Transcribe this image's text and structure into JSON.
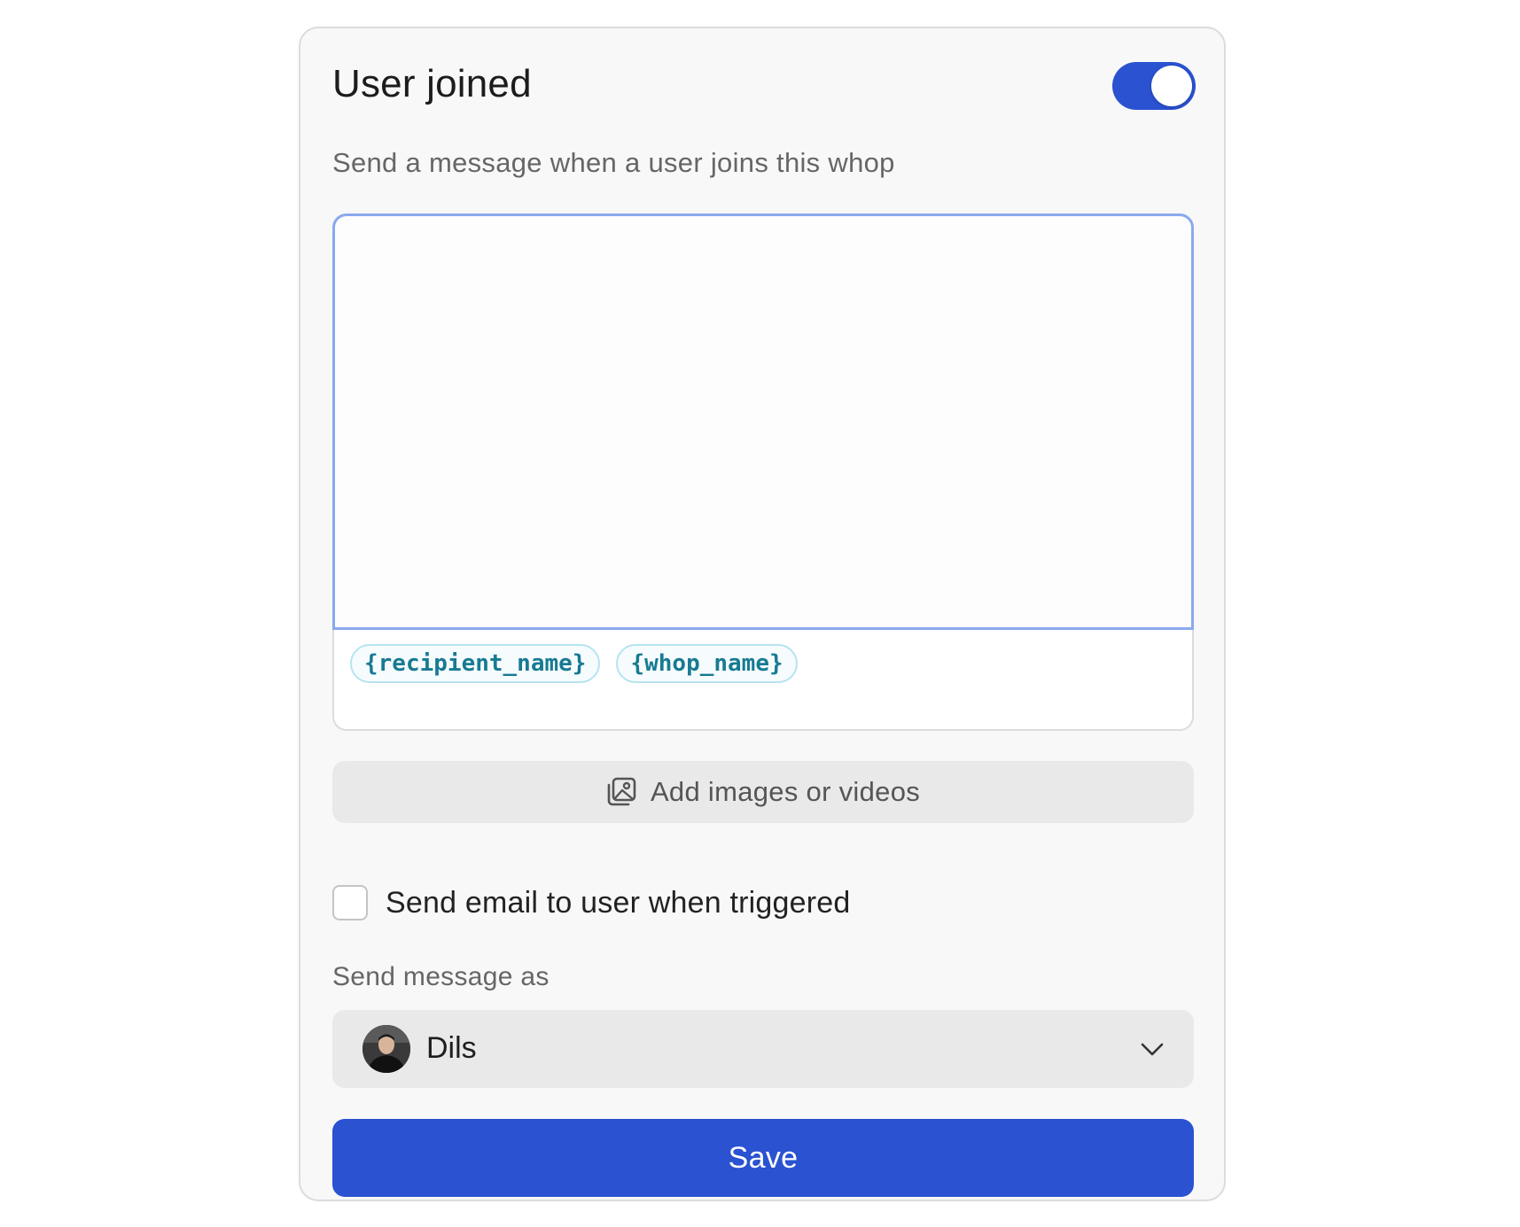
{
  "header": {
    "title": "User joined",
    "enabled": true
  },
  "subtitle": "Send a message when a user joins this whop",
  "editor": {
    "value": "",
    "variables": [
      "{recipient_name}",
      "{whop_name}"
    ]
  },
  "media": {
    "label": "Add images or videos",
    "icon": "image-gallery-icon"
  },
  "email_option": {
    "label": "Send email to user when triggered",
    "checked": false
  },
  "sender": {
    "label": "Send message as",
    "selected": "Dils",
    "icon": "chevron-down-icon"
  },
  "actions": {
    "save_label": "Save"
  },
  "colors": {
    "accent": "#2a52d1",
    "focus_border": "#8aa9ee",
    "chip_text": "#187a93"
  }
}
